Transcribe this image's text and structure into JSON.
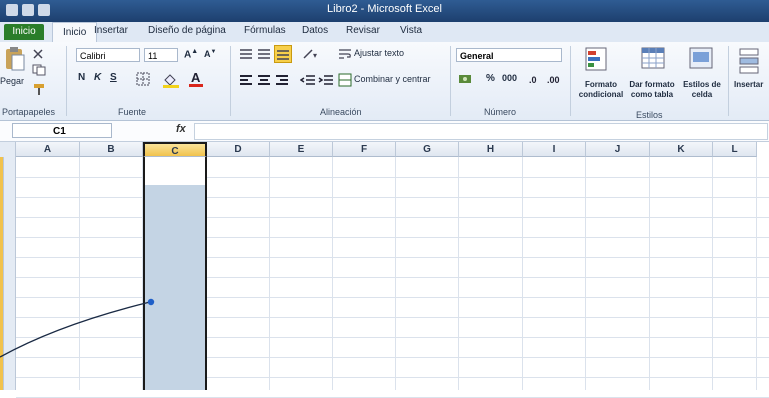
{
  "window": {
    "title": "Libro2 - Microsoft Excel"
  },
  "tabs": {
    "file": "Inicio",
    "home": "Inicio",
    "insert": "Insertar",
    "layout": "Diseño de página",
    "formulas": "Fórmulas",
    "data": "Datos",
    "review": "Revisar",
    "view": "Vista"
  },
  "ribbon": {
    "clipboard": {
      "paste": "Pegar",
      "label": "Portapapeles"
    },
    "font": {
      "name": "Calibri",
      "size": "11",
      "label": "Fuente"
    },
    "alignment": {
      "wrap": "Ajustar texto",
      "merge": "Combinar y centrar",
      "label": "Alineación"
    },
    "number": {
      "format": "General",
      "percent": "%",
      "thousands": "000",
      "label": "Número"
    },
    "styles": {
      "conditional": "Formato condicional",
      "table": "Dar formato como tabla",
      "cell": "Estilos de celda",
      "label": "Estilos"
    },
    "cells": {
      "insert": "Insertar"
    }
  },
  "formula_bar": {
    "cell": "C1",
    "fx": "fx",
    "value": ""
  },
  "grid": {
    "columns": [
      "A",
      "B",
      "C",
      "D",
      "E",
      "F",
      "G",
      "H",
      "I",
      "J",
      "K",
      "L"
    ],
    "selected_column": "C"
  }
}
